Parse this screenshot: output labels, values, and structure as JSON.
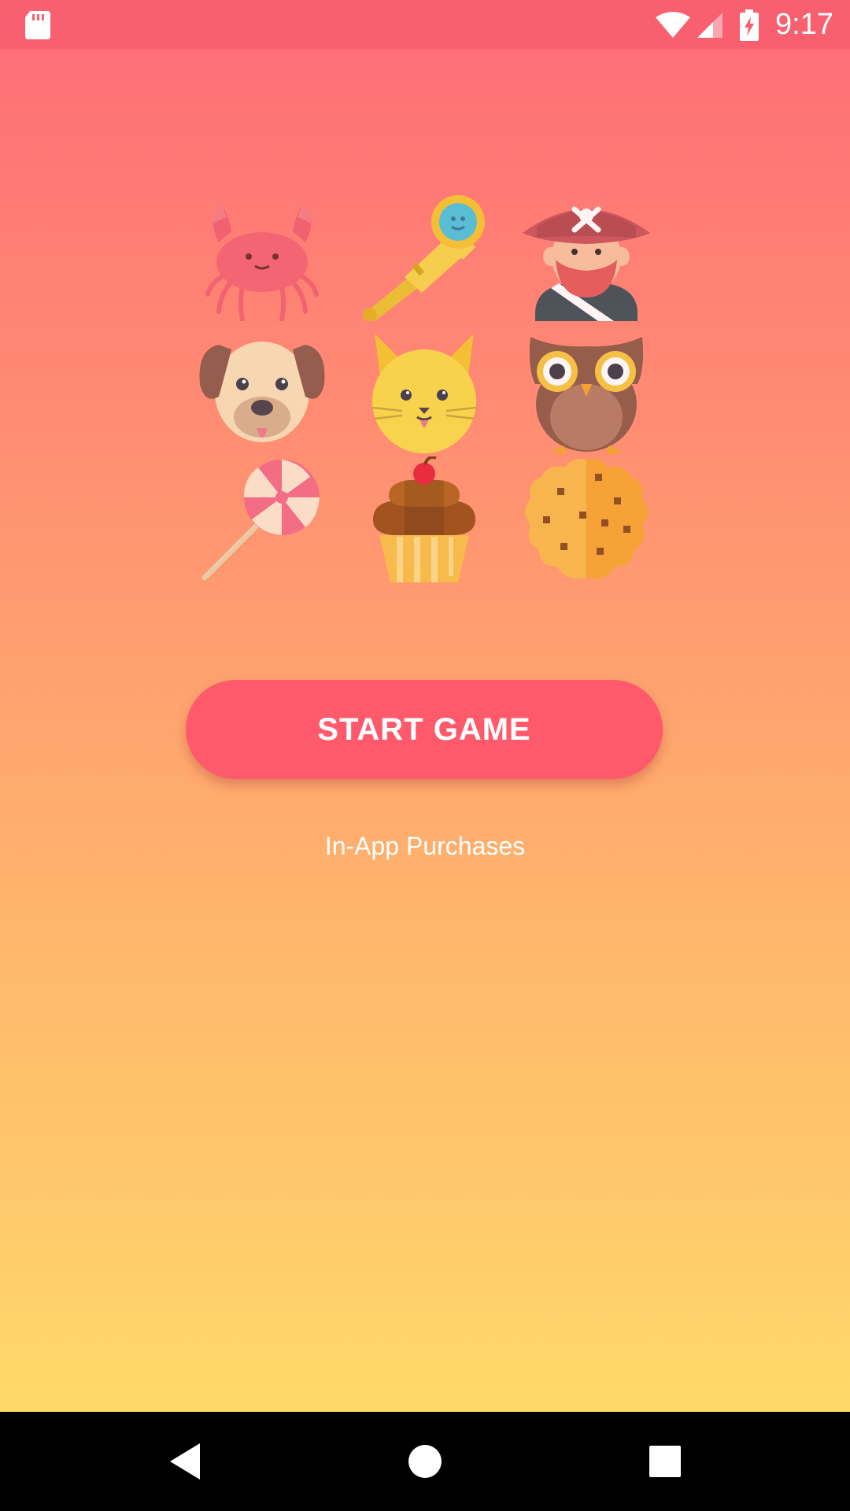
{
  "status_bar": {
    "time": "9:17",
    "icons": [
      "sd-card-icon",
      "wifi-icon",
      "cell-signal-icon",
      "battery-charging-icon"
    ],
    "background": "#F85F6F"
  },
  "icon_grid": {
    "items": [
      {
        "name": "crab-icon"
      },
      {
        "name": "telescope-icon"
      },
      {
        "name": "pirate-icon"
      },
      {
        "name": "dog-icon"
      },
      {
        "name": "cat-icon"
      },
      {
        "name": "owl-icon"
      },
      {
        "name": "lollipop-icon"
      },
      {
        "name": "cupcake-icon"
      },
      {
        "name": "cookie-icon"
      }
    ]
  },
  "main": {
    "start_button_label": "START GAME",
    "iap_link_label": "In-App Purchases"
  },
  "navigation": {
    "buttons": [
      "back-icon",
      "home-icon",
      "recents-icon"
    ]
  },
  "colors": {
    "gradient_top": "#FF6B78",
    "gradient_bottom": "#FFE06A",
    "button": "#FF5A6C",
    "text": "#FFFFFF"
  }
}
